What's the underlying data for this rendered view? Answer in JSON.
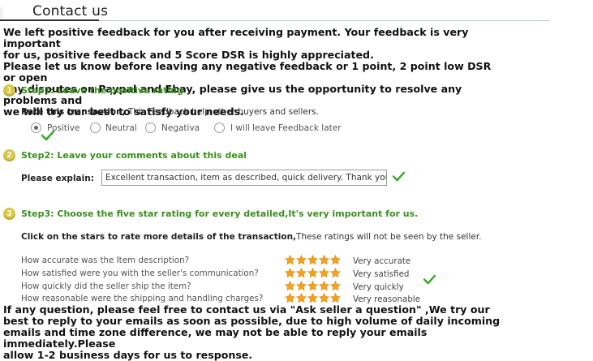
{
  "header": {
    "title": "Contact us"
  },
  "intro": "We left positive feedback for you after receiving payment. Your feedback is very important\nfor us, positive feedback and 5 Score DSR is highly appreciated.\nPlease let us know before leaving any negative feedback or 1 point, 2 point low DSR or open\nany disputes on Paypal and Ebay, please give us the opportunity to resolve any problems and\nwe will try our best to satisfy your needs.",
  "steps": [
    {
      "badge": "1",
      "title": "Step1: Leave the positive rating"
    },
    {
      "badge": "2",
      "title": "Step2: Leave your comments about this deal"
    },
    {
      "badge": "3",
      "title": "Step3: Choose the five star rating for every detailed,It's very important for us."
    }
  ],
  "rate": {
    "label": "Rate this transaction,",
    "hint": " This Feedback help other buyers and sellers.",
    "options": [
      "Positive",
      "Neutral",
      "Negativa",
      "I will leave Feedback later"
    ],
    "selected": "Positive"
  },
  "explain": {
    "label": "Please explain:",
    "value": "Excellent transaction, item as described, quick delivery. Thank you."
  },
  "dsr": {
    "intro_label": "Click on the stars to rate more details of the transaction,",
    "intro_hint": "These ratings will not be seen by the seller.",
    "rows": [
      {
        "question": "How accurate was the Item description?",
        "stars": 5,
        "rating": "Very accurate"
      },
      {
        "question": "How satisfied were you with the seller's communication?",
        "stars": 5,
        "rating": "Very satisfied"
      },
      {
        "question": "How quickly did the seller ship the item?",
        "stars": 5,
        "rating": "Very quickly"
      },
      {
        "question": "How reasonable were the shipping and handling charges?",
        "stars": 5,
        "rating": "Very reasonable"
      }
    ]
  },
  "outro": "If any question, please feel free to contact us via \"Ask seller a question\" ,We try our\nbest to reply to your emails as soon as possible, due to high volume of daily incoming\nemails and time zone difference, we may not be able to reply your emails immediately.Please\nallow 1-2 business days for us to response.",
  "colors": {
    "step_green": "#3a8f1d",
    "badge_yellow": "#d8c84a",
    "star_orange": "#f4a21a",
    "check_green": "#3aa62a"
  },
  "icons": [
    "step-badge-icon",
    "radio-icon",
    "star-icon",
    "checkmark-icon"
  ]
}
